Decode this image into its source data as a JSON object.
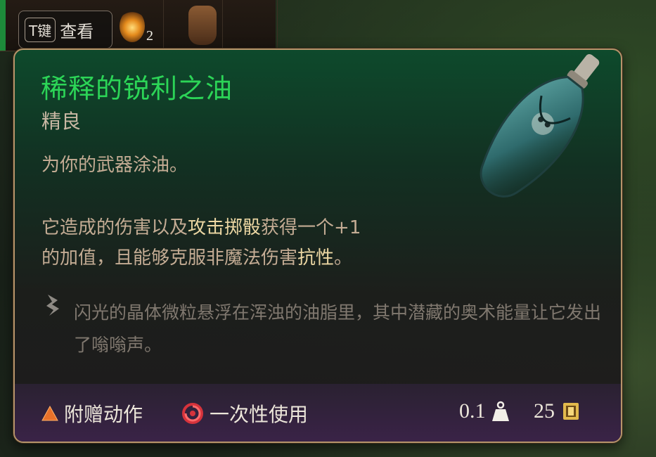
{
  "hotkey": {
    "key": "T键",
    "label": "查看"
  },
  "inventory": {
    "stack_count": "2"
  },
  "item": {
    "name": "稀释的锐利之油",
    "rarity": "精良",
    "description": "为你的武器涂油。",
    "effect": {
      "part1": "它造成的伤害以及",
      "highlight1": "攻击掷骰",
      "part2": "获得一个+1",
      "part3": "的加值，且能够克服非魔法伤害",
      "highlight2": "抗性",
      "part4": "。"
    },
    "lore": "闪光的晶体微粒悬浮在浑浊的油脂里，其中潜藏的奥术能量让它发出了嗡嗡声。"
  },
  "footer": {
    "bonus_action": "附赠动作",
    "single_use": "一次性使用",
    "weight": "0.1",
    "price": "25"
  },
  "colors": {
    "name": "#2cd557",
    "border": "#b6946a",
    "highlight": "#ecd7a3",
    "body_text": "#c4ac94",
    "lore_text": "#80786f",
    "bonus_action": "#e8712a",
    "single_use": "#d6333c"
  },
  "icons": [
    "bonus-action-icon",
    "single-use-icon",
    "weight-icon",
    "gold-coin-icon",
    "lore-quill-icon",
    "oil-vial-icon"
  ]
}
